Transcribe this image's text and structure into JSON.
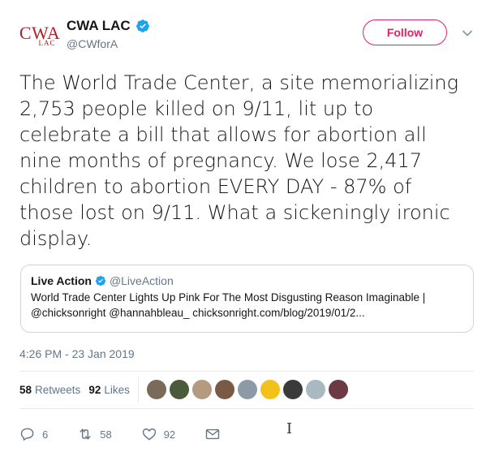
{
  "account": {
    "logo_text": "CWA",
    "logo_sub": "LAC",
    "display_name": "CWA LAC",
    "handle": "@CWforA",
    "follow_label": "Follow"
  },
  "tweet": {
    "text": "The World Trade Center, a site memorializing\n2,753 people killed on 9/11, lit up to\ncelebrate a bill that allows for abortion all\nnine months of pregnancy. We lose 2,417\nchildren to abortion EVERY DAY - 87% of\nthose lost on 9/11. What a sickeningly ironic\ndisplay.",
    "timestamp": "4:26 PM - 23 Jan 2019"
  },
  "quote": {
    "name": "Live Action",
    "handle": "@LiveAction",
    "line1": "World Trade Center Lights Up Pink For The Most Disgusting Reason Imaginable |",
    "line2": "@chicksonright @hannahbleau_ chicksonright.com/blog/2019/01/2..."
  },
  "stats": {
    "retweets_count": "58",
    "retweets_label": "Retweets",
    "likes_count": "92",
    "likes_label": "Likes"
  },
  "avatars": [
    "#7a6a5a",
    "#4a5a3a",
    "#b49a80",
    "#7b5a45",
    "#8c9aa8",
    "#f2c21b",
    "#3a3a3a",
    "#aab8c2",
    "#6b3a44"
  ],
  "actions": {
    "reply_count": "6",
    "retweet_count": "58",
    "like_count": "92"
  },
  "colors": {
    "accent": "#e0245e",
    "verified": "#1da1f2",
    "muted": "#657786",
    "logo": "#b5212a"
  }
}
